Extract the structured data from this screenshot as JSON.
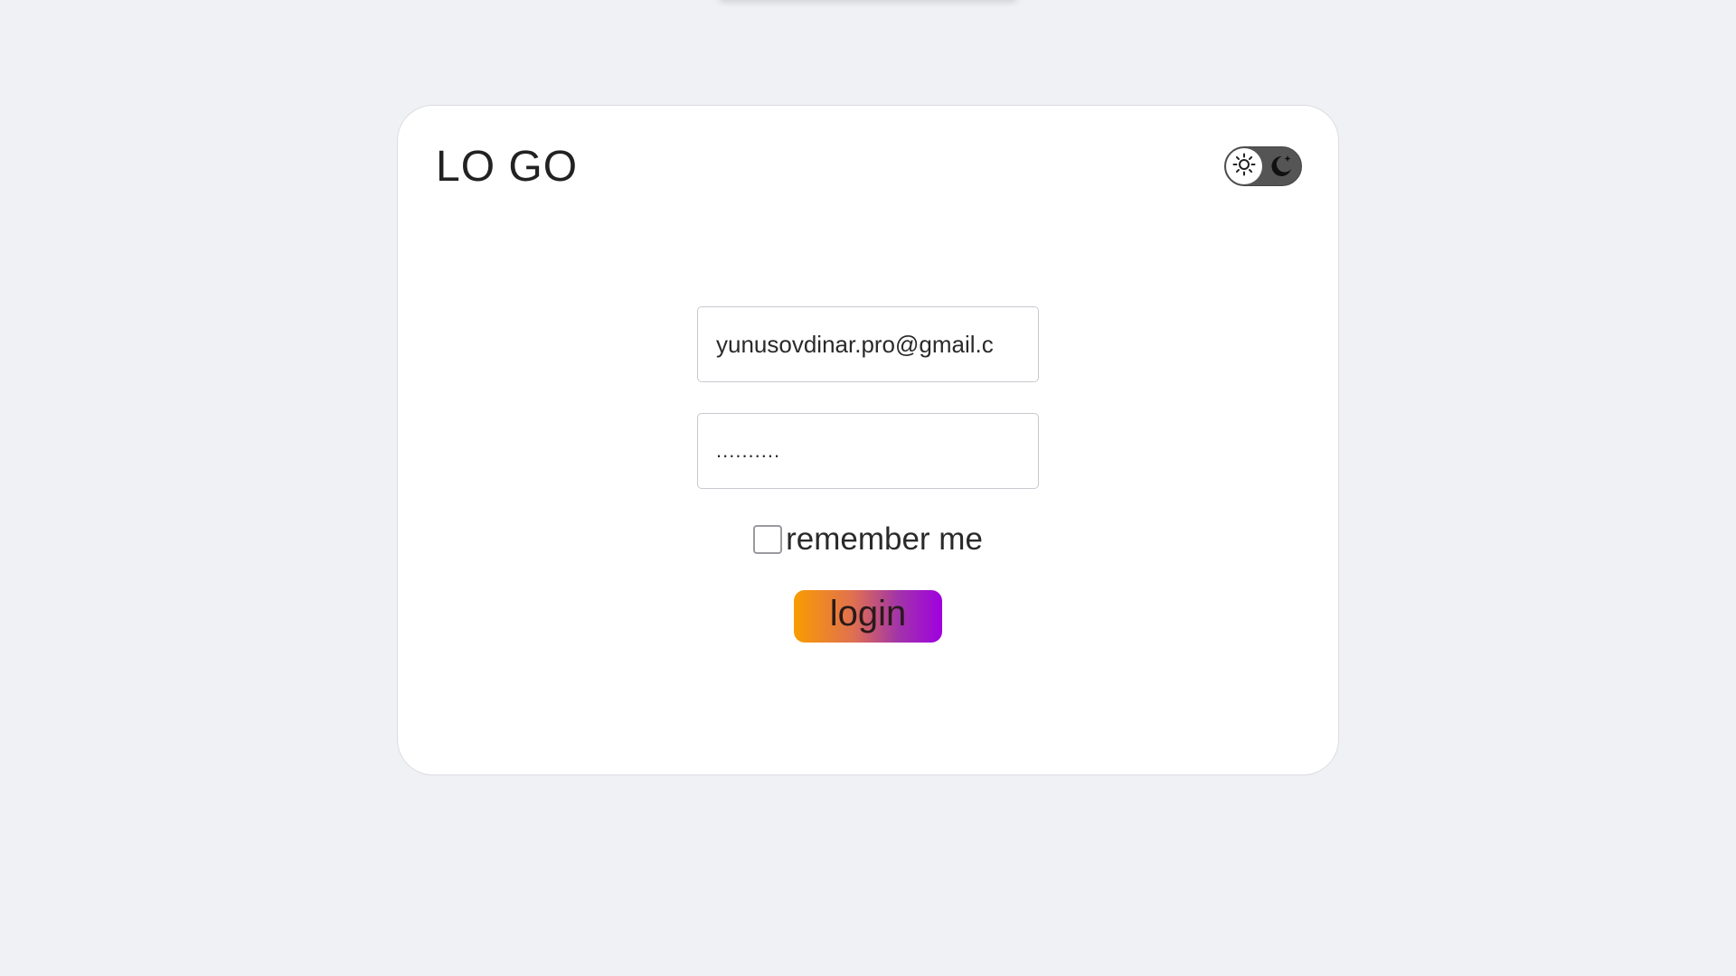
{
  "header": {
    "logo_text": "LO GO"
  },
  "theme_toggle": {
    "light_icon": "sun-icon",
    "dark_icon": "moon-icon",
    "state": "light"
  },
  "login_form": {
    "email_value": "yunusovdinar.pro@gmail.c",
    "password_value": "..........",
    "remember_label": "remember me",
    "remember_checked": false,
    "login_label": "login"
  },
  "colors": {
    "background": "#f0f1f5",
    "card": "#ffffff",
    "button_gradient_start": "#f99c00",
    "button_gradient_end": "#a000e0",
    "toggle_track": "#555555"
  }
}
